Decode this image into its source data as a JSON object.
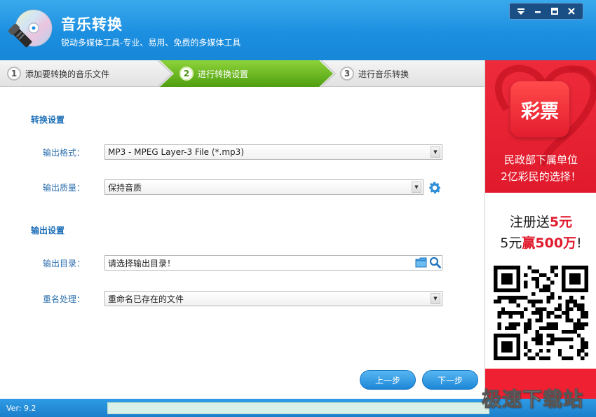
{
  "window": {
    "title": "音乐转换",
    "slogan": "锐动多媒体工具-专业、易用、免费的多媒体工具",
    "controls": [
      "menu-icon",
      "minimize-icon",
      "maximize-icon",
      "close-icon"
    ]
  },
  "steps": [
    {
      "num": "1",
      "label": "添加要转换的音乐文件",
      "active": false
    },
    {
      "num": "2",
      "label": "进行转换设置",
      "active": true
    },
    {
      "num": "3",
      "label": "进行音乐转换",
      "active": false
    }
  ],
  "conversion": {
    "section_title": "转换设置",
    "format_label": "输出格式：",
    "format_value": "MP3 - MPEG Layer-3 File (*.mp3)",
    "quality_label": "输出质量：",
    "quality_value": "保持音质"
  },
  "output": {
    "section_title": "输出设置",
    "dir_label": "输出目录：",
    "dir_value": "请选择输出目录！",
    "rename_label": "重名处理：",
    "rename_value": "重命名已存在的文件"
  },
  "buttons": {
    "prev": "上一步",
    "next": "下一步"
  },
  "ad": {
    "logo_text": "彩票",
    "line1": "民政部下属单位",
    "line2": "2亿彩民的选择！",
    "promo1_pre": "注册送",
    "promo1_red": "5元",
    "promo2_pre": "5元",
    "promo2_red": "赢500万",
    "promo2_post": "!"
  },
  "status": {
    "version": "Ver: 9.2",
    "progress": 0
  },
  "watermark": "极速下载站",
  "colors": {
    "accent_blue": "#1c8fe0",
    "active_step_green": "#6cbf1e",
    "ad_red": "#e01a2c"
  }
}
